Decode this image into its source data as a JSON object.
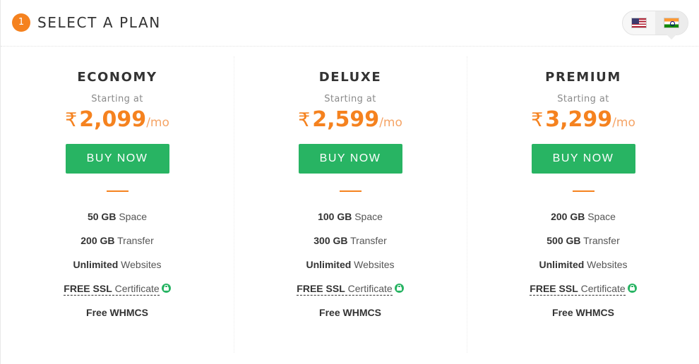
{
  "header": {
    "step_number": "1",
    "title": "SELECT A PLAN"
  },
  "currency_switch": {
    "options": [
      {
        "icon": "us-flag-icon",
        "active": false
      },
      {
        "icon": "india-flag-icon",
        "active": true
      }
    ]
  },
  "colors": {
    "accent": "#f5821f",
    "button": "#28b463",
    "lock": "#28b463"
  },
  "plans": [
    {
      "name": "ECONOMY",
      "starting_label": "Starting at",
      "currency_symbol": "₹",
      "price": "2,099",
      "period": "/mo",
      "button_label": "BUY NOW",
      "features": [
        {
          "bold": "50 GB",
          "text": " Space"
        },
        {
          "bold": "200 GB",
          "text": " Transfer"
        },
        {
          "bold": "Unlimited",
          "text": " Websites"
        },
        {
          "bold": "FREE SSL",
          "text": " Certificate"
        },
        {
          "bold": "Free WHMCS",
          "text": ""
        }
      ]
    },
    {
      "name": "DELUXE",
      "starting_label": "Starting at",
      "currency_symbol": "₹",
      "price": "2,599",
      "period": "/mo",
      "button_label": "BUY NOW",
      "features": [
        {
          "bold": "100 GB",
          "text": " Space"
        },
        {
          "bold": "300 GB",
          "text": " Transfer"
        },
        {
          "bold": "Unlimited",
          "text": " Websites"
        },
        {
          "bold": "FREE SSL",
          "text": " Certificate"
        },
        {
          "bold": "Free WHMCS",
          "text": ""
        }
      ]
    },
    {
      "name": "PREMIUM",
      "starting_label": "Starting at",
      "currency_symbol": "₹",
      "price": "3,299",
      "period": "/mo",
      "button_label": "BUY NOW",
      "features": [
        {
          "bold": "200 GB",
          "text": " Space"
        },
        {
          "bold": "500 GB",
          "text": " Transfer"
        },
        {
          "bold": "Unlimited",
          "text": " Websites"
        },
        {
          "bold": "FREE SSL",
          "text": " Certificate"
        },
        {
          "bold": "Free WHMCS",
          "text": ""
        }
      ]
    }
  ]
}
